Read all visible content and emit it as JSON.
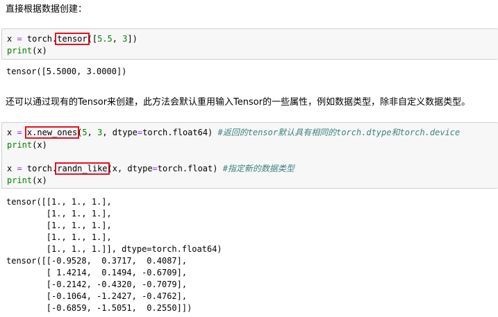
{
  "heading1": "直接根据数据创建：",
  "cell1": {
    "l1_pre": "x ",
    "l1_eq": "=",
    "l1_mid": " torch.",
    "l1_hl": "tensor",
    "l1_open": "([",
    "l1_n1": "5.5",
    "l1_sep": ", ",
    "l1_n2": "3",
    "l1_close": "])",
    "l2_print": "print",
    "l2_rest": "(x)"
  },
  "output1": "tensor([5.5000, 3.0000])",
  "heading2": "还可以通过现有的Tensor来创建，此方法会默认重用输入Tensor的一些属性，例如数据类型，除非自定义数据类型。",
  "cell2": {
    "l1_pre": "x ",
    "l1_eq": "=",
    "l1_sp": " ",
    "l1_hl": "x.new_ones",
    "l1_open": "(",
    "l1_n1": "5",
    "l1_s1": ", ",
    "l1_n2": "3",
    "l1_s2": ", dtype",
    "l1_eq2": "=",
    "l1_rest": "torch.float64) ",
    "l1_comment": "#返回的tensor默认具有相同的torch.dtype和torch.device",
    "l2_print": "print",
    "l2_rest": "(x)",
    "l4_pre": "x ",
    "l4_eq": "=",
    "l4_mid": " torch.",
    "l4_hl": "randn_like",
    "l4_a": "(x, dtype",
    "l4_eq2": "=",
    "l4_rest": "torch.float) ",
    "l4_comment": "#指定新的数据类型",
    "l5_print": "print",
    "l5_rest": "(x)"
  },
  "output2": [
    "tensor([[1., 1., 1.],",
    "        [1., 1., 1.],",
    "        [1., 1., 1.],",
    "        [1., 1., 1.],",
    "        [1., 1., 1.]], dtype=torch.float64)",
    "tensor([[-0.9528,  0.3717,  0.4087],",
    "        [ 1.4214,  0.1494, -0.6709],",
    "        [-0.2142, -0.4320, -0.7079],",
    "        [-0.1064, -1.2427, -0.4762],",
    "        [-0.6859, -1.5051,  0.2550]])"
  ]
}
